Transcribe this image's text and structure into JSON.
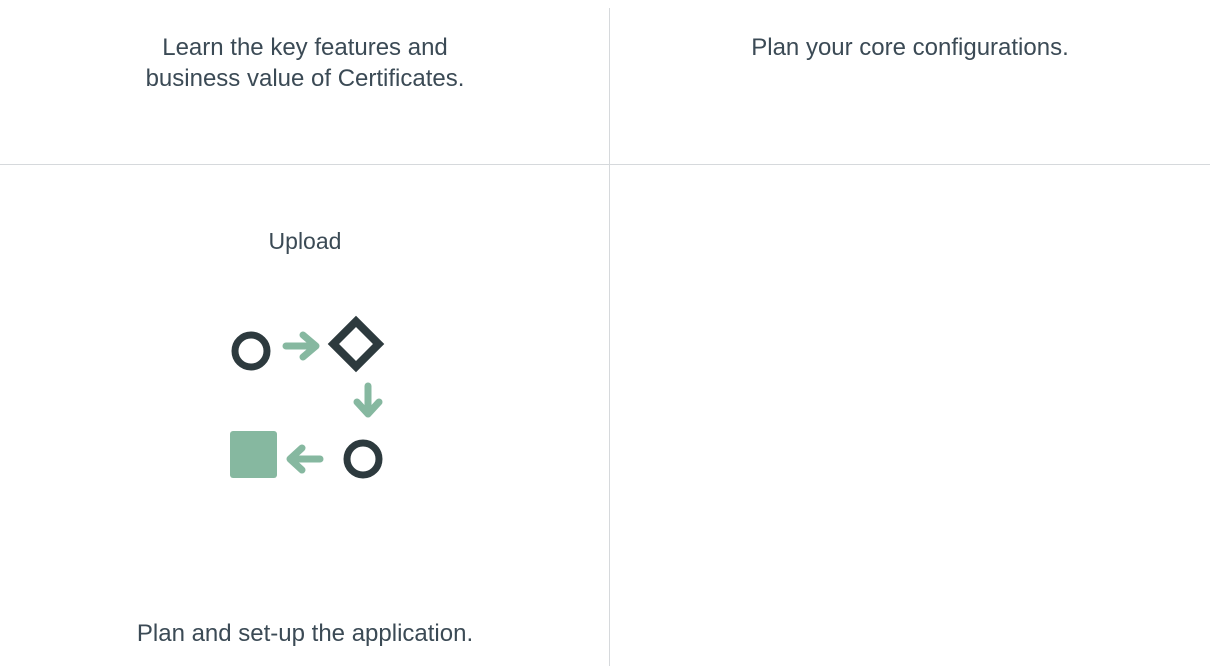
{
  "cards": {
    "learn": {
      "line1": "Learn the key features and",
      "line2": "business value of Certificates."
    },
    "plan_core": {
      "text": "Plan your core configurations."
    },
    "upload": {
      "label": "Upload",
      "icon": "workflow-icon",
      "description": "Plan and set-up the application."
    }
  },
  "colors": {
    "text": "#3b4a55",
    "divider": "#d6d9dc",
    "icon_dark": "#2d3a3e",
    "icon_accent": "#86b8a0"
  }
}
